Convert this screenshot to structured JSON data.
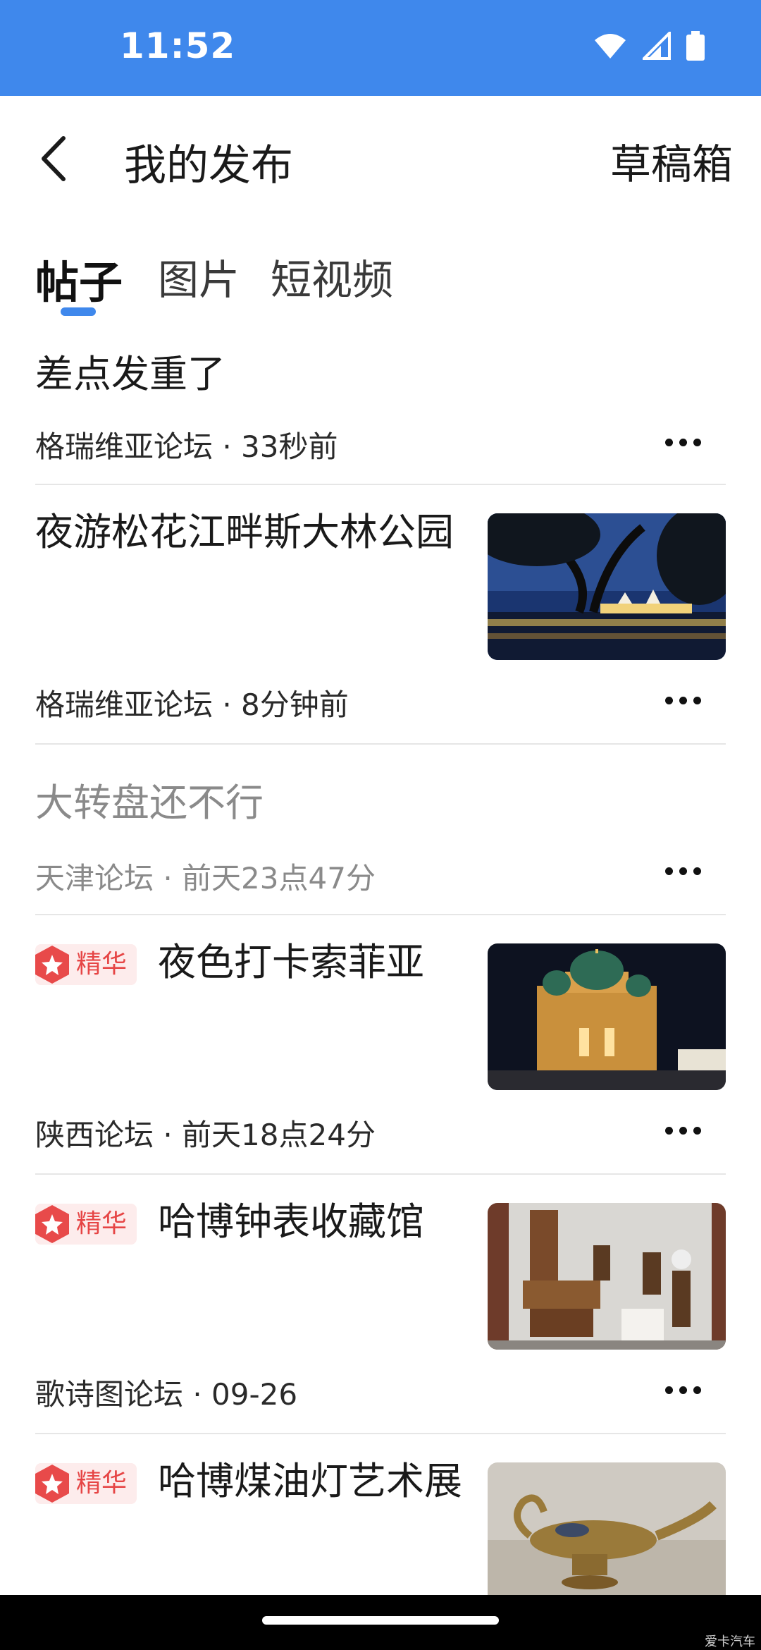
{
  "status_bar": {
    "time": "11:52",
    "bg_color": "#3f88ec"
  },
  "header": {
    "title": "我的发布",
    "back_icon": "chevron-left-icon",
    "drafts_label": "草稿箱"
  },
  "tabs": [
    {
      "label": "帖子",
      "active": true
    },
    {
      "label": "图片",
      "active": false
    },
    {
      "label": "短视频",
      "active": false
    }
  ],
  "accent_color": "#3f88ec",
  "posts": [
    {
      "title": "差点发重了",
      "meta": "格瑞维亚论坛 · 33秒前",
      "featured": false,
      "has_image": false,
      "dim": false
    },
    {
      "title": "夜游松花江畔斯大林公园",
      "meta": "格瑞维亚论坛 · 8分钟前",
      "featured": false,
      "has_image": true,
      "dim": false
    },
    {
      "title": "大转盘还不行",
      "meta": "天津论坛 · 前天23点47分",
      "featured": false,
      "has_image": false,
      "dim": true
    },
    {
      "title": "夜色打卡索菲亚",
      "meta": "陕西论坛 · 前天18点24分",
      "featured": true,
      "badge": "精华",
      "has_image": true,
      "dim": false
    },
    {
      "title": "哈博钟表收藏馆",
      "meta": "歌诗图论坛 · 09-26",
      "featured": true,
      "badge": "精华",
      "has_image": true,
      "dim": false
    },
    {
      "title": "哈博煤油灯艺术展",
      "meta": "",
      "featured": true,
      "badge": "精华",
      "has_image": true,
      "dim": false
    }
  ],
  "watermark": "爱卡汽车"
}
